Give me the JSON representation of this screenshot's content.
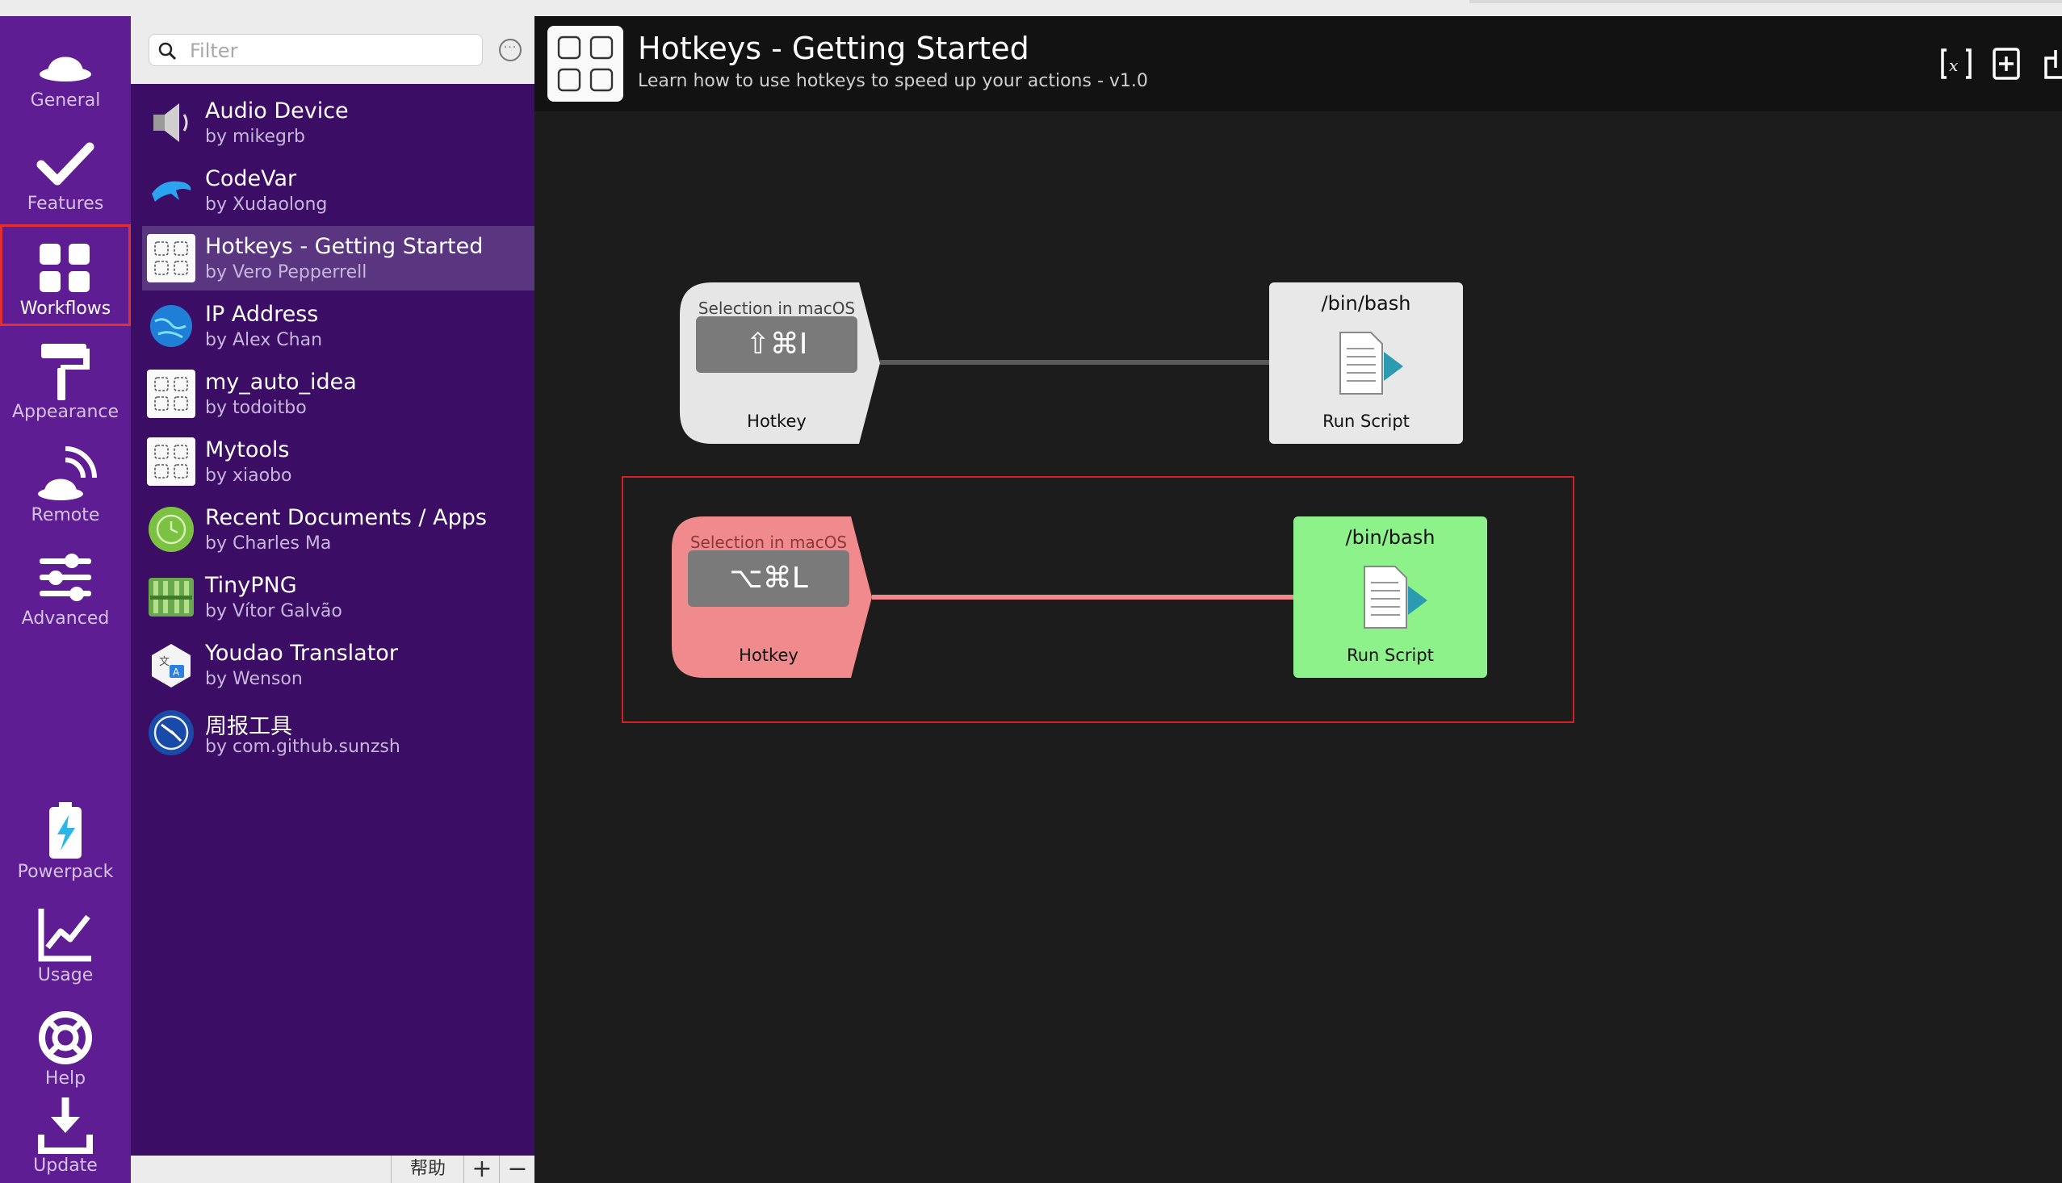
{
  "nav": {
    "items": [
      {
        "label": "General",
        "icon": "hat-icon"
      },
      {
        "label": "Features",
        "icon": "checkmark-icon"
      },
      {
        "label": "Workflows",
        "icon": "grid-icon",
        "active": true
      },
      {
        "label": "Appearance",
        "icon": "paint-roller-icon"
      },
      {
        "label": "Remote",
        "icon": "remote-icon"
      },
      {
        "label": "Advanced",
        "icon": "sliders-icon"
      },
      {
        "label": "Powerpack",
        "icon": "battery-bolt-icon"
      },
      {
        "label": "Usage",
        "icon": "chart-line-icon"
      },
      {
        "label": "Help",
        "icon": "lifebuoy-icon"
      },
      {
        "label": "Update",
        "icon": "download-icon"
      }
    ]
  },
  "list": {
    "filter_placeholder": "Filter",
    "more_label": "···",
    "workflows": [
      {
        "name": "Audio Device",
        "author": "by mikegrb",
        "icon": "speaker-icon"
      },
      {
        "name": "CodeVar",
        "author": "by Xudaolong",
        "icon": "dolphin-icon"
      },
      {
        "name": "Hotkeys - Getting Started",
        "author": "by Vero Pepperrell",
        "icon": "grid-icon",
        "selected": true
      },
      {
        "name": "IP Address",
        "author": "by Alex Chan",
        "icon": "globe-icon"
      },
      {
        "name": "my_auto_idea",
        "author": "by todoitbo",
        "icon": "grid-icon"
      },
      {
        "name": "Mytools",
        "author": "by xiaobo",
        "icon": "grid-icon"
      },
      {
        "name": "Recent Documents / Apps",
        "author": "by Charles Ma",
        "icon": "clock-icon"
      },
      {
        "name": "TinyPNG",
        "author": "by Vítor Galvão",
        "icon": "panda-icon"
      },
      {
        "name": "Youdao Translator",
        "author": "by Wenson",
        "icon": "translate-icon"
      },
      {
        "name": "周报工具",
        "author": "by com.github.sunzsh",
        "icon": "compass-icon"
      }
    ],
    "bottom": {
      "help": "帮助",
      "add": "+",
      "remove": "−"
    }
  },
  "header": {
    "title": "Hotkeys - Getting Started",
    "subtitle": "Learn how to use hotkeys to speed up your actions - v1.0"
  },
  "canvas": {
    "nodes": [
      {
        "trigger": {
          "label": "Selection in macOS",
          "keys": "⇧⌘I",
          "type": "Hotkey",
          "color": "#e6e6e6"
        },
        "action": {
          "name": "/bin/bash",
          "type": "Run Script",
          "color": "#e8e8e8"
        },
        "connector_color": "#5a5a5a"
      },
      {
        "trigger": {
          "label": "Selection in macOS",
          "keys": "⌥⌘L",
          "type": "Hotkey",
          "color": "#f08a8c"
        },
        "action": {
          "name": "/bin/bash",
          "type": "Run Script",
          "color": "#8ef28a"
        },
        "connector_color": "#f08a8c"
      }
    ]
  },
  "colors": {
    "nav_bg": "#5e1d92",
    "list_bg": "#3c0d64",
    "selection_frame": "#d42020"
  }
}
